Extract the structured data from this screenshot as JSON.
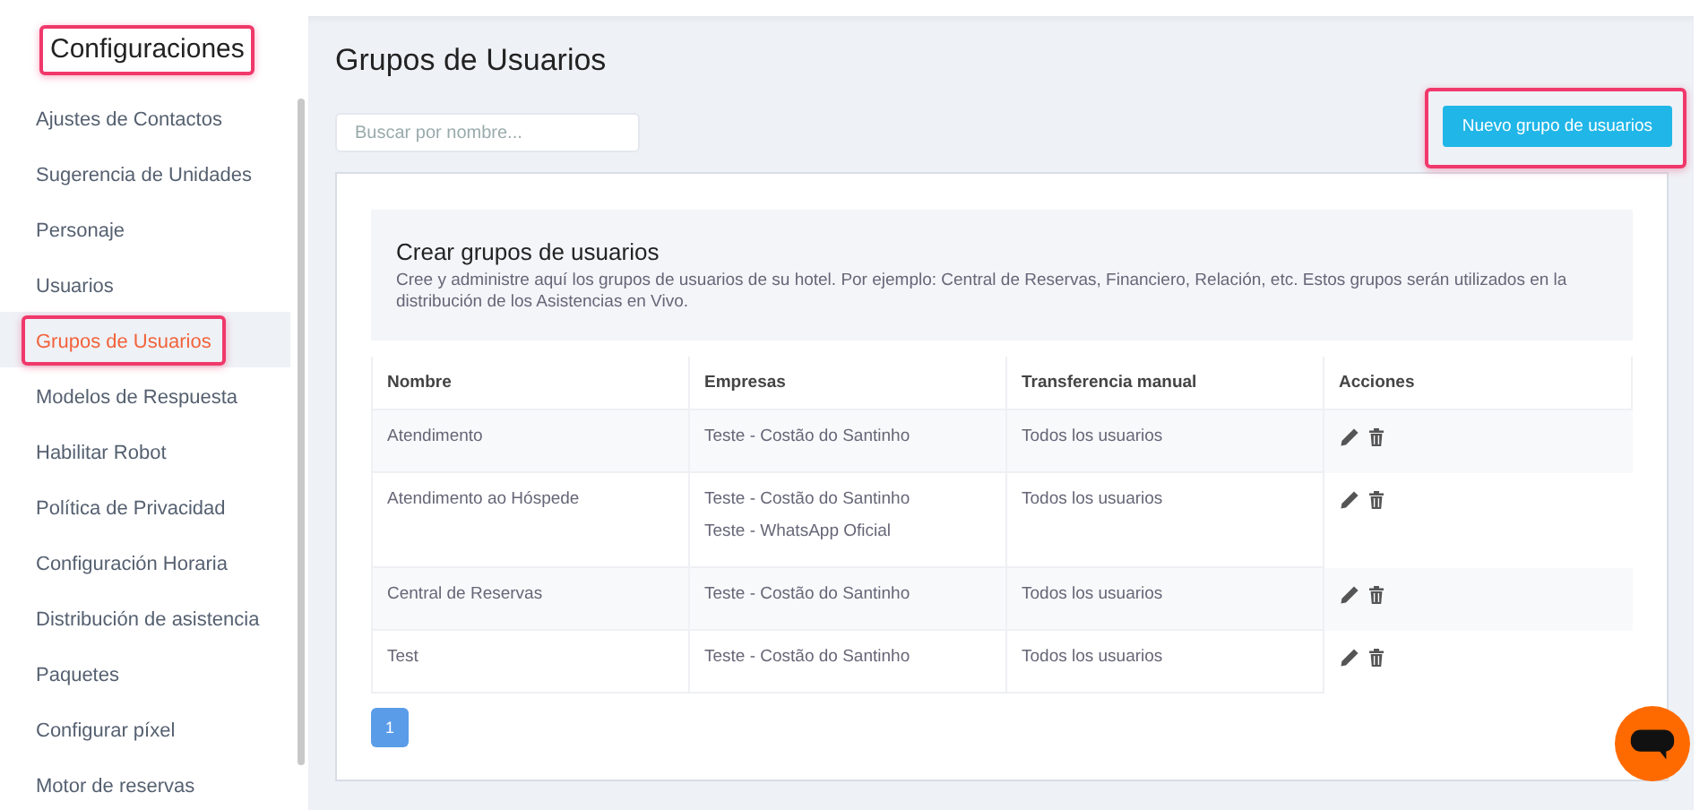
{
  "sidebar": {
    "title": {
      "text": "Configuraciones",
      "highlighted": true
    },
    "items": [
      {
        "label": "Ajustes de Contactos",
        "selected": false,
        "highlighted": false
      },
      {
        "label": "Sugerencia de Unidades",
        "selected": false,
        "highlighted": false
      },
      {
        "label": "Personaje",
        "selected": false,
        "highlighted": false
      },
      {
        "label": "Usuarios",
        "selected": false,
        "highlighted": false
      },
      {
        "label": "Grupos de Usuarios",
        "selected": true,
        "highlighted": true
      },
      {
        "label": "Modelos de Respuesta",
        "selected": false,
        "highlighted": false
      },
      {
        "label": "Habilitar Robot",
        "selected": false,
        "highlighted": false
      },
      {
        "label": "Política de Privacidad",
        "selected": false,
        "highlighted": false
      },
      {
        "label": "Configuración Horaria",
        "selected": false,
        "highlighted": false
      },
      {
        "label": "Distribución de asistencia",
        "selected": false,
        "highlighted": false
      },
      {
        "label": "Paquetes",
        "selected": false,
        "highlighted": false
      },
      {
        "label": "Configurar píxel",
        "selected": false,
        "highlighted": false
      },
      {
        "label": "Motor de reservas",
        "selected": false,
        "highlighted": false
      }
    ]
  },
  "page": {
    "title": "Grupos de Usuarios",
    "search": {
      "placeholder": "Buscar por nombre..."
    },
    "new_button": {
      "label": "Nuevo grupo de usuarios",
      "highlighted": true
    }
  },
  "intro": {
    "title": "Crear grupos de usuarios",
    "text": "Cree y administre aquí los grupos de usuarios de su hotel. Por ejemplo: Central de Reservas, Financiero, Relación, etc. Estos grupos serán utilizados en la distribución de los Asistencias en Vivo."
  },
  "table": {
    "columns": [
      "Nombre",
      "Empresas",
      "Transferencia manual",
      "Acciones"
    ],
    "rows": [
      {
        "name": "Atendimento",
        "companies": [
          "Teste - Costão do Santinho"
        ],
        "transfer": "Todos los usuarios"
      },
      {
        "name": "Atendimento ao Hóspede",
        "companies": [
          "Teste - Costão do Santinho",
          "Teste - WhatsApp Oficial"
        ],
        "transfer": "Todos los usuarios"
      },
      {
        "name": "Central de Reservas",
        "companies": [
          "Teste - Costão do Santinho"
        ],
        "transfer": "Todos los usuarios"
      },
      {
        "name": "Test",
        "companies": [
          "Teste - Costão do Santinho"
        ],
        "transfer": "Todos los usuarios"
      }
    ]
  },
  "pagination": [
    {
      "label": "1",
      "selected": true
    }
  ]
}
